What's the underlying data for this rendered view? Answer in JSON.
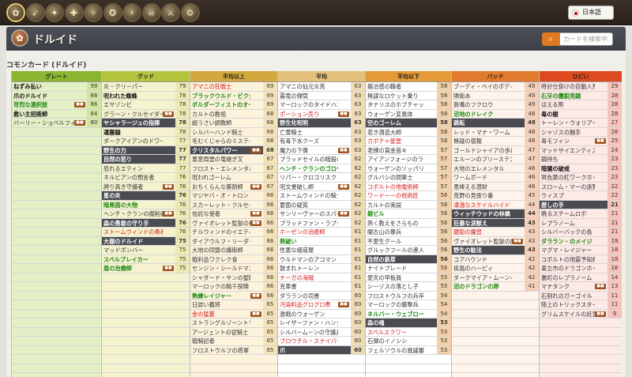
{
  "lang": "日本語",
  "page_title": "ドルイド",
  "search": {
    "placeholder": "カードを検索中.",
    "icon": "search-icon"
  },
  "subtitle": "コモンカード (ドルイド)",
  "class_icons": [
    "druid",
    "hunter",
    "mage",
    "paladin",
    "priest",
    "rogue",
    "shaman",
    "warlock",
    "warrior",
    "neutral"
  ],
  "columns": [
    {
      "title": "グレート",
      "head": "#8bb431",
      "tint": "#e3efc4",
      "score_bg": "#d2e5a0",
      "rows": [
        [
          "b",
          "ねずみ払い",
          "99",
          ""
        ],
        [
          "b",
          "爪のドルイド",
          "88",
          ""
        ],
        [
          "g",
          "苛烈な選択肢",
          "86",
          "badge"
        ],
        [
          "b",
          "救い主招術師",
          "84",
          ""
        ],
        [
          "n",
          "バーリー・ショベルフィスト",
          "80",
          "badge"
        ]
      ]
    },
    {
      "title": "グッド",
      "head": "#b4c53d",
      "tint": "#f5f3cf",
      "score_bg": "#ece9b2",
      "rows": [
        [
          "n",
          "炎・クリーパー",
          "79",
          ""
        ],
        [
          "b",
          "呪われた蜘蛛",
          "78",
          ""
        ],
        [
          "n",
          "エサゾンビ",
          "78",
          ""
        ],
        [
          "n",
          "グラーン・クルセイダー",
          "78",
          "badge"
        ],
        [
          "hd",
          "ヤシャラージュの指揮",
          "78",
          ""
        ],
        [
          "b",
          "運搬錨",
          "78",
          ""
        ],
        [
          "n",
          "ダークアイアンのドワーフ",
          "77",
          ""
        ],
        [
          "hd",
          "野生の力",
          "77",
          ""
        ],
        [
          "hd",
          "自然の怒り",
          "77",
          ""
        ],
        [
          "n",
          "恐れるエティン",
          "77",
          ""
        ],
        [
          "n",
          "ネルビアンの預言者",
          "76",
          ""
        ],
        [
          "n",
          "誇り高き守護者",
          "76",
          "badge"
        ],
        [
          "hd",
          "星の炎",
          "76",
          ""
        ],
        [
          "g",
          "暗黒面の大物",
          "76",
          ""
        ],
        [
          "n",
          "ヘンチ・クランの掘削者",
          "76",
          "badge"
        ],
        [
          "hd",
          "森の勇敢の守り手",
          "76",
          ""
        ],
        [
          "r",
          "ストームウィンドの勇者",
          "76",
          ""
        ],
        [
          "hd",
          "大樹のドルイド",
          "75",
          ""
        ],
        [
          "n",
          "マッドボンバー",
          "75",
          ""
        ],
        [
          "g",
          "スペルブレイカー",
          "75",
          ""
        ],
        [
          "g",
          "盾の治療師",
          "75",
          "badge"
        ]
      ]
    },
    {
      "title": "平均以上",
      "head": "#d3a93d",
      "tint": "#fdf3dd",
      "score_bg": "#f5e3b8",
      "rows": [
        [
          "r",
          "アマニの狂戦士",
          "69",
          ""
        ],
        [
          "g",
          "ブラックウルド・ピクシー",
          "69",
          ""
        ],
        [
          "g",
          "ボルダーフィストのオーガ",
          "69",
          ""
        ],
        [
          "n",
          "カルトの教祖",
          "68",
          ""
        ],
        [
          "n",
          "超うさい調教師",
          "68",
          ""
        ],
        [
          "n",
          "シルバーハンド騎士",
          "68",
          ""
        ],
        [
          "n",
          "毛むくじゃらのミスティック",
          "68",
          ""
        ],
        [
          "hd",
          "クリスタルパワー",
          "68",
          "badge"
        ],
        [
          "n",
          "悪意周雲の竜継ぎ又",
          "67",
          ""
        ],
        [
          "n",
          "フロスト・エレメンタル",
          "67",
          ""
        ],
        [
          "n",
          "呪われゴーレム",
          "67",
          ""
        ],
        [
          "n",
          "おちくらんな薬剤師",
          "67",
          "badge"
        ],
        [
          "n",
          "マジヤバ・オ・トロン",
          "66",
          ""
        ],
        [
          "n",
          "スカーレット・クルセイダー",
          "66",
          ""
        ],
        [
          "n",
          "信託な使者",
          "66",
          "badge"
        ],
        [
          "n",
          "ヴァイオレット監獄の看守",
          "66",
          "badge"
        ],
        [
          "n",
          "チルウィンドのイエティ",
          "66",
          ""
        ],
        [
          "n",
          "ダイアウルフ・リーダー",
          "66",
          ""
        ],
        [
          "n",
          "大地の同盟の護衛師",
          "66",
          ""
        ],
        [
          "n",
          "戦利品ワクレク食",
          "66",
          ""
        ],
        [
          "n",
          "センジン・シールドマスタ",
          "66",
          ""
        ],
        [
          "n",
          "シャダード・サンの聖職者",
          "66",
          ""
        ],
        [
          "n",
          "マーロックの精千探険",
          "66",
          ""
        ],
        [
          "g",
          "熟練レイジャー",
          "66",
          "badge"
        ],
        [
          "n",
          "日誌い義将",
          "65",
          ""
        ],
        [
          "r",
          "金の猛蒼",
          "65",
          "badge"
        ],
        [
          "n",
          "ストラングルゾーントラ",
          "65",
          ""
        ],
        [
          "n",
          "アージェントの従騎士",
          "65",
          ""
        ],
        [
          "n",
          "戦騎記者",
          "65",
          ""
        ],
        [
          "n",
          "フロストウルフの将軍",
          "65",
          ""
        ]
      ]
    },
    {
      "title": "平均",
      "head": "#e3c17a",
      "tint": "#fff",
      "score_bg": "#f0dcb3",
      "rows": [
        [
          "n",
          "アマニの仙元炎亮",
          "63",
          ""
        ],
        [
          "n",
          "震竜の弾筒",
          "63",
          ""
        ],
        [
          "n",
          "マーロックのタイドハンター",
          "63",
          ""
        ],
        [
          "r",
          "ポーション売り",
          "63",
          "badge"
        ],
        [
          "hd",
          "野生化呪明",
          "63",
          ""
        ],
        [
          "n",
          "亡霊騎士",
          "63",
          ""
        ],
        [
          "n",
          "有毒下水クーズ",
          "63",
          ""
        ],
        [
          "n",
          "魔力の下僕",
          "63",
          "badge"
        ],
        [
          "n",
          "ブラッドセイルの暗殺者",
          "62",
          ""
        ],
        [
          "g",
          "ヘンチ・クランのゴロゲキ",
          "62",
          ""
        ],
        [
          "n",
          "リパー・クロコリスク",
          "62",
          ""
        ],
        [
          "n",
          "呪文書破し師",
          "62",
          "badge"
        ],
        [
          "n",
          "ストームウィンドの騎士",
          "62",
          ""
        ],
        [
          "n",
          "要面の疑質",
          "62",
          ""
        ],
        [
          "n",
          "サンリーヴァーのスパイ",
          "62",
          "badge"
        ],
        [
          "n",
          "ブラッドファン・ラプター",
          "62",
          ""
        ],
        [
          "r",
          "ホーゼンの治癒師",
          "61",
          ""
        ],
        [
          "g",
          "熱破い",
          "61",
          ""
        ],
        [
          "n",
          "性悪な細道屋",
          "61",
          ""
        ],
        [
          "n",
          "ウルドマンのアコマンドー",
          "61",
          ""
        ],
        [
          "n",
          "鼓まれトーレン",
          "61",
          ""
        ],
        [
          "r",
          "ナーガの海賊",
          "61",
          ""
        ],
        [
          "n",
          "克車書",
          "61",
          ""
        ],
        [
          "n",
          "ダラランの司書",
          "60",
          ""
        ],
        [
          "r",
          "汚染料品グログロ煮",
          "60",
          "badge"
        ],
        [
          "n",
          "激戦のウォーゲン",
          "60",
          ""
        ],
        [
          "n",
          "レイザーファン・ハンター",
          "60",
          ""
        ],
        [
          "n",
          "シルバームーンの守護兵",
          "60",
          ""
        ],
        [
          "r",
          "ブロウチル・スナイパー",
          "60",
          ""
        ],
        [
          "hd",
          "爪",
          "60",
          ""
        ]
      ]
    },
    {
      "title": "平均以下",
      "head": "#e59a36",
      "tint": "#fff",
      "score_bg": "#f2cfa6",
      "rows": [
        [
          "n",
          "鍛冶感の職者",
          "58",
          ""
        ],
        [
          "n",
          "無謀なロケット乗り",
          "58",
          ""
        ],
        [
          "n",
          "タナリスのホブチャッパー",
          "58",
          ""
        ],
        [
          "n",
          "ウォーゲン変異体",
          "58",
          ""
        ],
        [
          "hd",
          "空のゴーレム",
          "58",
          ""
        ],
        [
          "n",
          "若き酒造大師",
          "58",
          ""
        ],
        [
          "r",
          "カボチャ星雲",
          "58",
          ""
        ],
        [
          "n",
          "老練の賞金首キ",
          "57",
          ""
        ],
        [
          "n",
          "アイアンフォージのライフル兵",
          "57",
          ""
        ],
        [
          "n",
          "ウォーゲンのソッパリ",
          "57",
          ""
        ],
        [
          "n",
          "グルバシの間軍士",
          "57",
          ""
        ],
        [
          "r",
          "コボルトの地電術師",
          "57",
          ""
        ],
        [
          "r",
          "ワードーーの祝術匠",
          "56",
          ""
        ],
        [
          "n",
          "カルトの実誤",
          "56",
          ""
        ],
        [
          "g",
          "鎧ビル",
          "56",
          ""
        ],
        [
          "n",
          "熱く教えをさらもの",
          "56",
          ""
        ],
        [
          "n",
          "闇古山の暴兵",
          "56",
          ""
        ],
        [
          "n",
          "不愛生グール",
          "56",
          ""
        ],
        [
          "n",
          "グルックフールの連人",
          "56",
          ""
        ],
        [
          "hd",
          "自然の鉄草",
          "56",
          ""
        ],
        [
          "n",
          "ナイトブレード",
          "56",
          ""
        ],
        [
          "n",
          "愛天の甲板員",
          "55",
          ""
        ],
        [
          "n",
          "シーゾスの落とし子",
          "55",
          ""
        ],
        [
          "n",
          "フロストウルフの兵卒",
          "54",
          ""
        ],
        [
          "n",
          "マーロックの襲撃兵",
          "54",
          ""
        ],
        [
          "g",
          "ネルバー・ウェブロード",
          "54",
          ""
        ],
        [
          "hd",
          "森の魂",
          "53",
          ""
        ],
        [
          "r",
          "スペルスクワー",
          "53",
          ""
        ],
        [
          "n",
          "石弾のイノシシ",
          "53",
          ""
        ],
        [
          "n",
          "フェルソウルの異議審問官",
          "53",
          ""
        ]
      ]
    },
    {
      "title": "バッド",
      "head": "#e27a2d",
      "tint": "#fff4ec",
      "score_bg": "#f6cfb6",
      "rows": [
        [
          "n",
          "ブーディ・ベイのボディガード",
          "49",
          ""
        ],
        [
          "n",
          "隣衛あ",
          "49",
          ""
        ],
        [
          "n",
          "鉄嘴のフクロウ",
          "49",
          ""
        ],
        [
          "g",
          "沼地のドレイク",
          "48",
          ""
        ],
        [
          "hd",
          "跳転",
          "48",
          ""
        ],
        [
          "n",
          "レッド・マナ・ワーム",
          "48",
          ""
        ],
        [
          "n",
          "無疑の宿報",
          "48",
          ""
        ],
        [
          "n",
          "ゴールドシャイアの歩兵",
          "47",
          ""
        ],
        [
          "n",
          "エルーンのブリーステス",
          "47",
          ""
        ],
        [
          "n",
          "大地のエレメンタル",
          "46",
          ""
        ],
        [
          "n",
          "ワームボード",
          "46",
          ""
        ],
        [
          "n",
          "墨棒える潜財",
          "46",
          ""
        ],
        [
          "n",
          "荒野の見張り番",
          "45",
          ""
        ],
        [
          "r",
          "凍温なスケイルハイド",
          "44",
          ""
        ],
        [
          "hd",
          "ウィッチウッドの林檎",
          "44",
          ""
        ],
        [
          "hd",
          "狂暴な涙獣え",
          "43",
          ""
        ],
        [
          "r",
          "鍵鉛の魔習",
          "43",
          ""
        ],
        [
          "n",
          "ヴァイオレット監獄の魔剣士",
          "43",
          "badge"
        ],
        [
          "hd",
          "野生の勧法",
          "43",
          ""
        ],
        [
          "n",
          "コアハウンド",
          "42",
          ""
        ],
        [
          "n",
          "疾風のハーピィ",
          "42",
          ""
        ],
        [
          "n",
          "ダークマイア・ムーンキン",
          "42",
          ""
        ],
        [
          "g",
          "沼のドラゴンの卵",
          "41",
          ""
        ]
      ]
    },
    {
      "title": "ひどい",
      "head": "#dd4a1f",
      "tint": "#fde9e6",
      "score_bg": "#f5c3bb",
      "rows": [
        [
          "n",
          "時計仕掛けの自動人形",
          "29",
          ""
        ],
        [
          "g",
          "石牙の鷹鋭亮鍋",
          "28",
          ""
        ],
        [
          "n",
          "ほえる熊",
          "28",
          ""
        ],
        [
          "b",
          "毒の樹",
          "28",
          ""
        ],
        [
          "n",
          "トーレン・ウォリアー",
          "27",
          ""
        ],
        [
          "n",
          "シャゾスの触手",
          "26",
          ""
        ],
        [
          "n",
          "毒モフィン",
          "25",
          "badge"
        ],
        [
          "n",
          "マッドサイエンティスト",
          "24",
          ""
        ],
        [
          "n",
          "錆持ち",
          "23",
          ""
        ],
        [
          "b",
          "暗闇の破戒",
          "23",
          ""
        ],
        [
          "n",
          "冥色葉の紅ワークホーク",
          "23",
          ""
        ],
        [
          "n",
          "スローム・マーの遠覧師",
          "22",
          ""
        ],
        [
          "n",
          "ウィスプ",
          "22",
          ""
        ],
        [
          "hd",
          "歴しの手",
          "21",
          ""
        ],
        [
          "n",
          "暁るスチームロボ",
          "21",
          ""
        ],
        [
          "n",
          "レプラノーム",
          "21",
          ""
        ],
        [
          "n",
          "シルバーバックの長",
          "21",
          ""
        ],
        [
          "g",
          "ダララン・のメイジ",
          "19",
          ""
        ],
        [
          "n",
          "マグマ・レイジャー",
          "18",
          ""
        ],
        [
          "n",
          "コボルトの地震予知師",
          "18",
          ""
        ],
        [
          "n",
          "東立市のドラゴンホーク",
          "16",
          ""
        ],
        [
          "n",
          "裏町のレプラノーム",
          "14",
          ""
        ],
        [
          "n",
          "マナタンク",
          "13",
          "badge"
        ],
        [
          "n",
          "石割れのガーゴイル",
          "11",
          ""
        ],
        [
          "n",
          "陸上のトリックスター",
          "11",
          ""
        ],
        [
          "n",
          "グリムスケイルの託宣師",
          "9",
          "badge"
        ]
      ]
    }
  ]
}
